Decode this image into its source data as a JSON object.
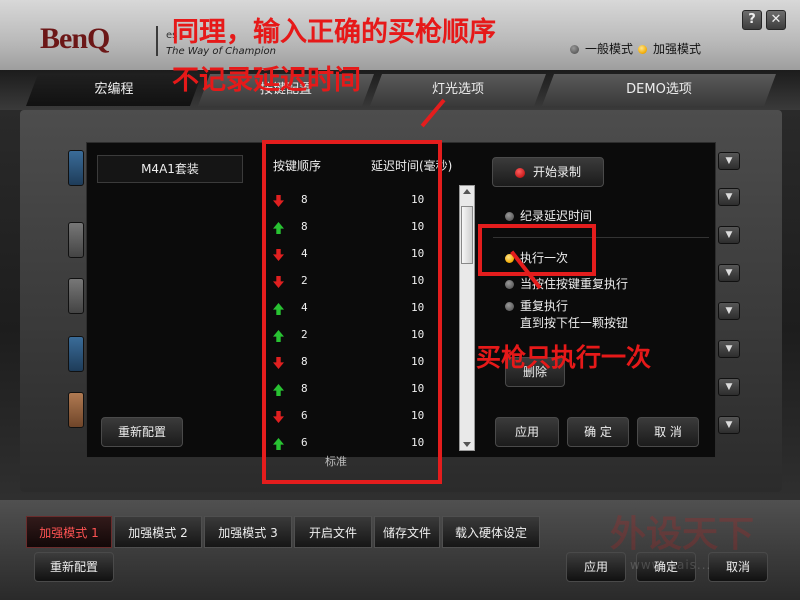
{
  "header": {
    "brand": "BenQ",
    "tagline_top": "es",
    "tagline": "The Way of Champion",
    "help_label": "?",
    "close_label": "✕",
    "modes": [
      {
        "label": "一般模式",
        "selected": false
      },
      {
        "label": "加强模式",
        "selected": true
      }
    ]
  },
  "tabs": [
    {
      "label": "宏编程",
      "active": true
    },
    {
      "label": "按键配置",
      "active": false
    },
    {
      "label": "灯光选项",
      "active": false
    },
    {
      "label": "DEMO选项",
      "active": false
    }
  ],
  "macro_editor": {
    "preset_name": "M4A1套装",
    "reset_button": "重新配置",
    "list_headers": {
      "sequence": "按键顺序",
      "delay": "延迟时间(毫秒)"
    },
    "rows": [
      {
        "action": "down",
        "key": "8",
        "delay": "10"
      },
      {
        "action": "up",
        "key": "8",
        "delay": "10"
      },
      {
        "action": "down",
        "key": "4",
        "delay": "10"
      },
      {
        "action": "down",
        "key": "2",
        "delay": "10"
      },
      {
        "action": "up",
        "key": "4",
        "delay": "10"
      },
      {
        "action": "up",
        "key": "2",
        "delay": "10"
      },
      {
        "action": "down",
        "key": "8",
        "delay": "10"
      },
      {
        "action": "up",
        "key": "8",
        "delay": "10"
      },
      {
        "action": "down",
        "key": "6",
        "delay": "10"
      },
      {
        "action": "up",
        "key": "6",
        "delay": "10"
      }
    ],
    "below_list_text": "标准",
    "record_button": "开始录制",
    "record_delay_option": "纪录延迟时间",
    "execute_options": [
      {
        "label": "执行一次",
        "selected": true
      },
      {
        "label": "当按住按键重复执行",
        "selected": false
      },
      {
        "label": "重复执行",
        "label2": "直到按下任一颗按钮",
        "selected": false
      }
    ],
    "delete_button": "删除",
    "apply_button": "应用",
    "ok_button": "确 定",
    "cancel_button": "取 消"
  },
  "bottom": {
    "tabs": [
      {
        "label": "加强模式",
        "num": "1",
        "active": true
      },
      {
        "label": "加强模式",
        "num": "2",
        "active": false
      },
      {
        "label": "加强模式",
        "num": "3",
        "active": false
      },
      {
        "label": "开启文件",
        "active": false
      },
      {
        "label": "储存文件",
        "active": false
      },
      {
        "label": "载入硬体设定",
        "active": false
      }
    ],
    "reset_button": "重新配置",
    "apply_button": "应用",
    "ok_button": "确定",
    "cancel_button": "取消"
  },
  "annotations": {
    "title": "同理，输入正确的买枪顺序",
    "subtitle": "不记录延迟时间",
    "note": "买枪只执行一次"
  },
  "watermark": {
    "text": "外设天下",
    "sub": "www.wais..."
  },
  "colors": {
    "annotation_red": "#e41d1d",
    "active_tab_red": "#ff5353",
    "led_orange": "#f1a900",
    "record_red": "#d11a1a"
  }
}
